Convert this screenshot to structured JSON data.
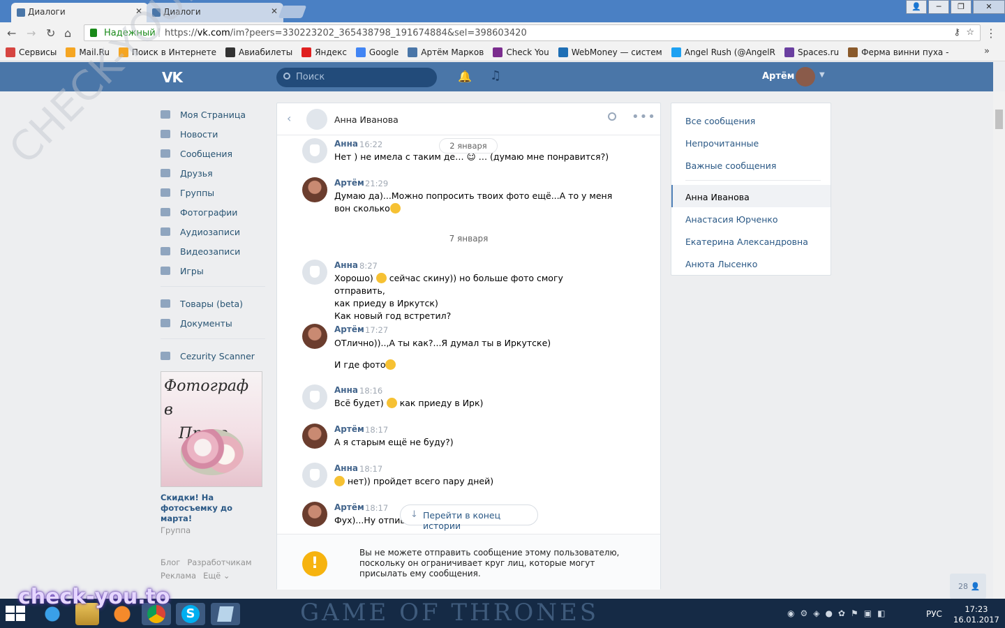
{
  "browser": {
    "tabs": [
      {
        "title": "Диалоги",
        "active": true
      },
      {
        "title": "Диалоги",
        "active": false
      }
    ],
    "secure_label": "Надежный",
    "url_prefix": "https://",
    "url_host": "vk.com",
    "url_path": "/im?peers=330223202_365438798_191674884&sel=398603420",
    "bookmarks": [
      {
        "label": "Сервисы",
        "color": "#d64541"
      },
      {
        "label": "Mail.Ru",
        "color": "#f5a623"
      },
      {
        "label": "Поиск в Интернете",
        "color": "#f5a623"
      },
      {
        "label": "Авиабилеты",
        "color": "#333333"
      },
      {
        "label": "Яндекс",
        "color": "#e02020"
      },
      {
        "label": "Google",
        "color": "#4285f4"
      },
      {
        "label": "Артём Марков",
        "color": "#4a76a8"
      },
      {
        "label": "Check You",
        "color": "#7b2d8e"
      },
      {
        "label": "WebMoney — систем",
        "color": "#1f6fb5"
      },
      {
        "label": "Angel Rush (@AngelR",
        "color": "#1da1f2"
      },
      {
        "label": "Spaces.ru",
        "color": "#6a3fa0"
      },
      {
        "label": "Ферма винни пуха -",
        "color": "#8a5a2b"
      }
    ]
  },
  "vk": {
    "logo": "VK",
    "search_placeholder": "Поиск",
    "user_name": "Артём"
  },
  "left_menu": {
    "items": [
      "Моя Страница",
      "Новости",
      "Сообщения",
      "Друзья",
      "Группы",
      "Фотографии",
      "Аудиозаписи",
      "Видеозаписи",
      "Игры"
    ],
    "items2": [
      "Товары (beta)",
      "Документы"
    ],
    "items3": [
      "Cezurity Scanner"
    ],
    "promo_text1": "Фотограф в",
    "promo_text2": "Праге",
    "promo_title": "Скидки! На фотосъемку до марта!",
    "promo_sub": "Группа",
    "footer": [
      "Блог",
      "Разработчикам",
      "Реклама",
      "Ещё ⌄"
    ]
  },
  "chat": {
    "peer_name": "Анна Иванова",
    "date_pill": "2 января",
    "date_divider": "7 января",
    "messages": [
      {
        "author": "Анна",
        "time": "16:22",
        "lines": [
          "Нет ) не имела с таким де… ☺ … (думаю мне понравится?)"
        ]
      },
      {
        "author": "Артём",
        "time": "21:29",
        "lines": [
          "Думаю да)...Можно попросить твоих фото ещё...А то у меня",
          "вон сколько"
        ]
      },
      {
        "author": "Анна",
        "time": "8:27",
        "lines": [
          "Хорошо)",
          "сейчас скину)) но больше фото смогу отправить,",
          "как приеду в Иркутск)",
          "Как новый год встретил?"
        ]
      },
      {
        "author": "Артём",
        "time": "17:27",
        "lines": [
          "ОТлично))..,А ты как?...Я думал ты в Иркутске)",
          "И где фото"
        ]
      },
      {
        "author": "Анна",
        "time": "18:16",
        "lines": [
          "Всё будет)",
          "как приеду в Ирк)"
        ]
      },
      {
        "author": "Артём",
        "time": "18:17",
        "lines": [
          "А я старым ещё не буду?)"
        ]
      },
      {
        "author": "Анна",
        "time": "18:17",
        "lines": [
          "нет)) пройдет всего пару дней)"
        ]
      },
      {
        "author": "Артём",
        "time": "18:17",
        "lines": [
          "Фух)...Ну отпиш"
        ]
      }
    ],
    "goto_end": "Перейти в конец истории",
    "warning": "Вы не можете отправить сообщение этому пользователю, поскольку он ограничивает круг лиц, которые могут присылать ему сообщения."
  },
  "right_panel": {
    "filters": [
      "Все сообщения",
      "Непрочитанные",
      "Важные сообщения"
    ],
    "dialogs": [
      "Анна Иванова",
      "Анастасия Юрченко",
      "Екатерина Александровна",
      "Анюта Лысенко"
    ]
  },
  "counter": "28",
  "taskbar": {
    "banner": "GAME OF THRONES",
    "lang": "РУС",
    "time": "17:23",
    "date": "16.01.2017"
  },
  "watermarks": {
    "diagonal": "CHECK-YOU.ME",
    "corner": "check-you.to"
  }
}
